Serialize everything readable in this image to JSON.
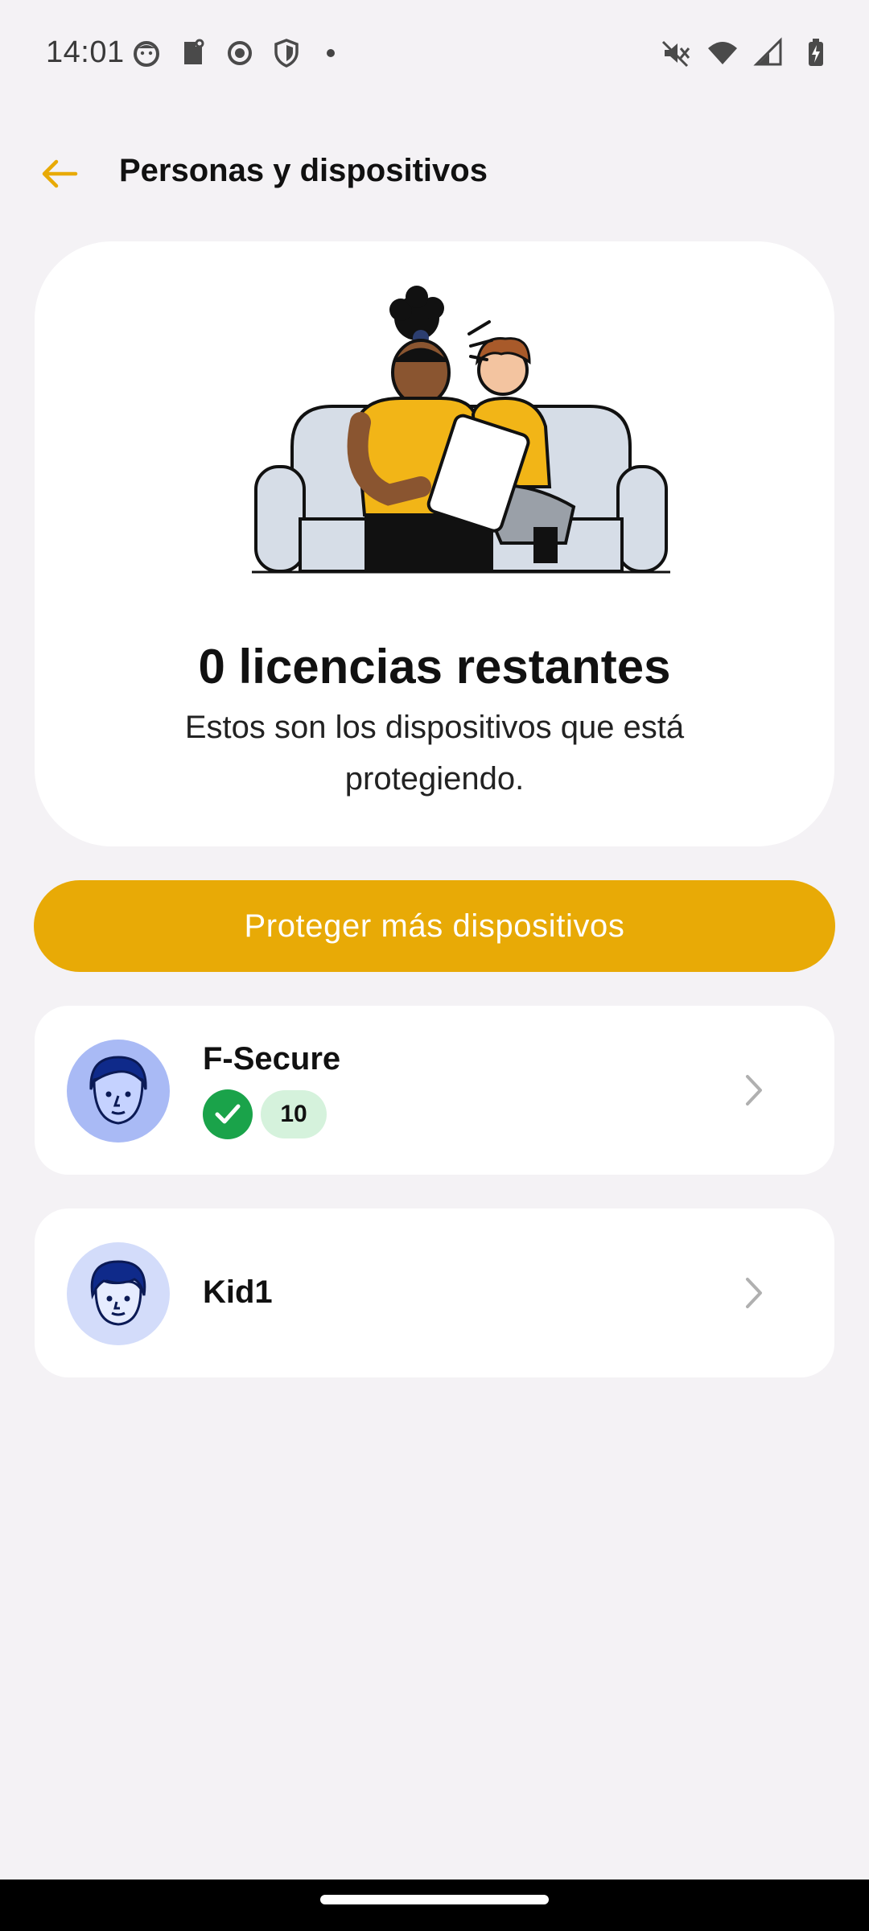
{
  "status_bar": {
    "time": "14:01",
    "left_icons": [
      "face-icon",
      "clipboard-icon",
      "location-icon",
      "shield-icon",
      "dot-icon"
    ],
    "right_icons": [
      "mute-icon",
      "wifi-icon",
      "signal-icon",
      "battery-icon"
    ]
  },
  "header": {
    "title": "Personas y dispositivos",
    "back_icon": "arrow-left-icon"
  },
  "hero": {
    "title": "0 licencias restantes",
    "subtitle": "Estos son los dispositivos que está protegiendo."
  },
  "cta": {
    "label": "Proteger más dispositivos"
  },
  "profiles": [
    {
      "name": "F-Secure",
      "status": "protected",
      "device_count": "10"
    },
    {
      "name": "Kid1"
    }
  ],
  "colors": {
    "accent": "#e8aa06",
    "background": "#f4f2f5",
    "success": "#1aa34a",
    "count_pill": "#d5f2dc",
    "avatar_adult": "#a9baf5",
    "avatar_kid": "#d3dcfa"
  }
}
